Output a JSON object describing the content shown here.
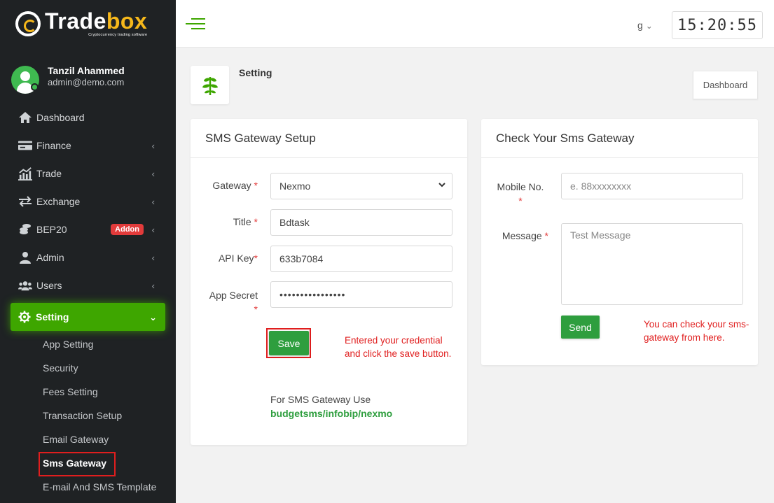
{
  "brand": {
    "name_main": "Trade",
    "name_accent": "box",
    "tagline": "Cryptocurrency trading software"
  },
  "user": {
    "name": "Tanzil Ahammed",
    "email": "admin@demo.com"
  },
  "sidebar": {
    "items": [
      {
        "label": "Dashboard"
      },
      {
        "label": "Finance"
      },
      {
        "label": "Trade"
      },
      {
        "label": "Exchange"
      },
      {
        "label": "BEP20",
        "badge": "Addon"
      },
      {
        "label": "Admin"
      },
      {
        "label": "Users"
      },
      {
        "label": "Setting"
      }
    ],
    "sub_items": [
      {
        "label": "App Setting"
      },
      {
        "label": "Security"
      },
      {
        "label": "Fees Setting"
      },
      {
        "label": "Transaction Setup"
      },
      {
        "label": "Email Gateway"
      },
      {
        "label": "Sms Gateway"
      },
      {
        "label": "E-mail And SMS Template"
      }
    ]
  },
  "topbar": {
    "language": "g",
    "clock": "15:20:55"
  },
  "page": {
    "title": "Setting",
    "breadcrumb_button": "Dashboard"
  },
  "sms_setup": {
    "title": "SMS Gateway Setup",
    "gateway_label": "Gateway",
    "gateway_value": "Nexmo",
    "title_label": "Title",
    "title_value": "Bdtask",
    "api_key_label": "API Key",
    "api_key_value": "633b7084",
    "app_secret_label": "App Secret",
    "app_secret_value": "••••••••••••••••",
    "required_mark": "*",
    "save_label": "Save",
    "annotation_line1": "Entered your credential",
    "annotation_line2": "and click the save button.",
    "footnote_line1": "For SMS Gateway Use",
    "footnote_link": "budgetsms/infobip/nexmo"
  },
  "sms_check": {
    "title": "Check Your Sms Gateway",
    "mobile_label": "Mobile No.",
    "mobile_placeholder": "e. 88xxxxxxxx",
    "message_label": "Message",
    "message_placeholder": "Test Message",
    "required_mark": "*",
    "send_label": "Send",
    "annotation_line1": "You can check your sms-",
    "annotation_line2": "gateway from here."
  },
  "colors": {
    "accent": "#3ea600",
    "button": "#2e9e3e",
    "sidebar_bg": "#1f2224",
    "highlight": "#e01e1e",
    "brand_yellow": "#f6b81b"
  }
}
